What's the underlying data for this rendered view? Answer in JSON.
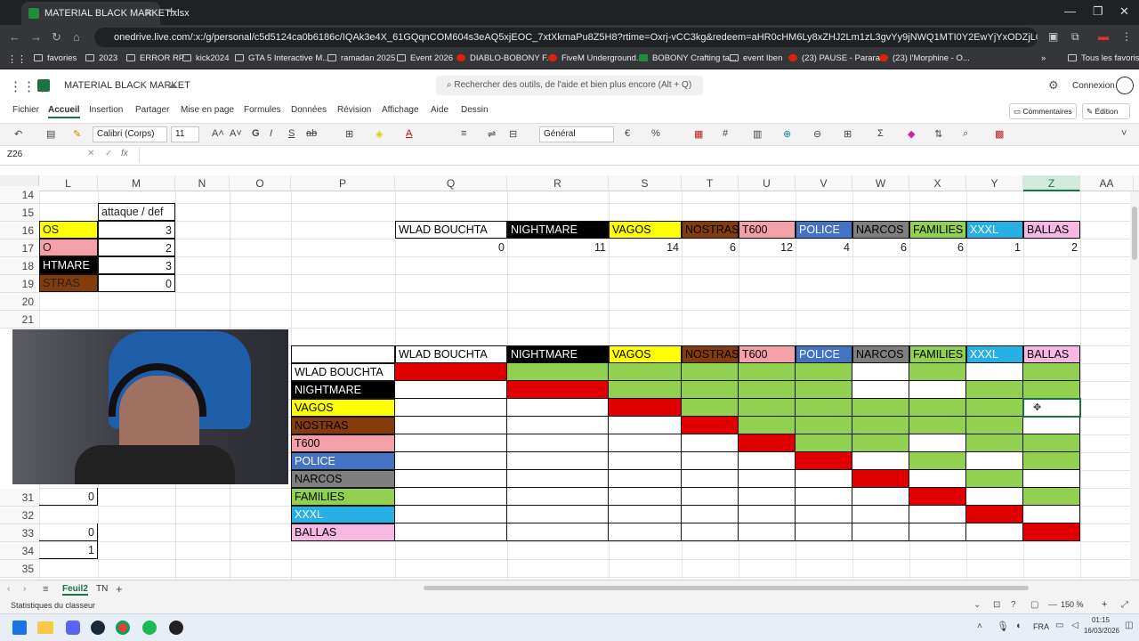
{
  "browser": {
    "tab_title": "MATERIAL BLACK MARKET.xlsx",
    "url": "onedrive.live.com/:x:/g/personal/c5d5124ca0b6186c/IQAk3e4X_61GQqnCOM604s3eAQ5xjEOC_7xtXkmaPu8Z5H8?rtime=Oxrj-vCC3kg&redeem=aHR0cHM6Ly8xZHJ2Lm1zL3gvYy9jNWQ1MTI0Y2EwYjYxODZjL0lRQWszZTRYXzYxR1FxbkNPTTYwNHMz",
    "bookmarks": [
      "favories",
      "2023",
      "ERROR RP",
      "kick2024",
      "GTA 5 Interactive M...",
      "ramadan 2025",
      "Event 2026",
      "DIABLO-BOBONY F...",
      "FiveM Underground...",
      "BOBONY Crafting ta...",
      "event Iben",
      "(23) PAUSE - Parara...",
      "(23) l'Morphine - O..."
    ],
    "all_favorites": "Tous les favoris"
  },
  "app": {
    "doc_title": "MATERIAL BLACK MARKET",
    "search_placeholder": "Rechercher des outils, de l'aide et bien plus encore (Alt + Q)",
    "signin": "Connexion",
    "comments": "Commentaires",
    "edit_mode": "Édition",
    "ribbon_tabs": [
      "Fichier",
      "Accueil",
      "Insertion",
      "Partager",
      "Mise en page",
      "Formules",
      "Données",
      "Révision",
      "Affichage",
      "Aide",
      "Dessin"
    ],
    "font_name": "Calibri (Corps)",
    "font_size": "11",
    "number_format": "Général",
    "name_box": "Z26"
  },
  "grid": {
    "columns": [
      "L",
      "M",
      "N",
      "O",
      "P",
      "Q",
      "R",
      "S",
      "T",
      "U",
      "V",
      "W",
      "X",
      "Y",
      "Z",
      "AA"
    ],
    "selected_column": "Z",
    "rows": [
      "14",
      "15",
      "16",
      "17",
      "18",
      "19",
      "20",
      "21",
      "31",
      "32",
      "33",
      "34",
      "35"
    ],
    "left_table": {
      "header": "attaque / def",
      "names": [
        "OS",
        "O",
        "HTMARE",
        "STRAS"
      ],
      "values": [
        "3",
        "2",
        "3",
        "0"
      ]
    },
    "left_lower_values": {
      "r31": "0",
      "r33": "0",
      "r34": "1"
    },
    "top_table": {
      "gangs": [
        "WLAD BOUCHTA",
        "NIGHTMARE",
        "VAGOS",
        "NOSTRAS",
        "T600",
        "POLICE",
        "NARCOS",
        "FAMILIES",
        "XXXL",
        "BALLAS"
      ],
      "counts": [
        "0",
        "11",
        "14",
        "6",
        "12",
        "4",
        "6",
        "6",
        "1",
        "2"
      ]
    },
    "gang_colors": [
      "#ffffff",
      "#000000",
      "#ffff00",
      "#843c0c",
      "#f4a0a8",
      "#4472c4",
      "#7f7f7f",
      "#92d050",
      "#26b0e6",
      "#f7b7e3"
    ],
    "gang_text_colors": [
      "#000000",
      "#ffffff",
      "#000000",
      "#000000",
      "#000000",
      "#ffffff",
      "#000000",
      "#000000",
      "#ffffff",
      "#000000"
    ],
    "matrix_legend": {
      "red": "#e00000",
      "green": "#92d050"
    },
    "matrix": [
      [
        "R",
        "G",
        "G",
        "G",
        "G",
        "G",
        "W",
        "G",
        "W",
        "G"
      ],
      [
        "W",
        "R",
        "G",
        "G",
        "G",
        "G",
        "W",
        "W",
        "G",
        "G"
      ],
      [
        "W",
        "W",
        "R",
        "G",
        "G",
        "G",
        "G",
        "G",
        "G",
        "W"
      ],
      [
        "W",
        "W",
        "W",
        "R",
        "G",
        "G",
        "G",
        "G",
        "G",
        "W"
      ],
      [
        "W",
        "W",
        "W",
        "W",
        "R",
        "G",
        "G",
        "W",
        "G",
        "G"
      ],
      [
        "W",
        "W",
        "W",
        "W",
        "W",
        "R",
        "W",
        "G",
        "W",
        "G"
      ],
      [
        "W",
        "W",
        "W",
        "W",
        "W",
        "W",
        "R",
        "W",
        "G",
        "W"
      ],
      [
        "W",
        "W",
        "W",
        "W",
        "W",
        "W",
        "W",
        "R",
        "W",
        "G"
      ],
      [
        "W",
        "W",
        "W",
        "W",
        "W",
        "W",
        "W",
        "W",
        "R",
        "W"
      ],
      [
        "W",
        "W",
        "W",
        "W",
        "W",
        "W",
        "W",
        "W",
        "W",
        "R"
      ]
    ]
  },
  "sheets": [
    "Feuil2",
    "TN"
  ],
  "status": {
    "left": "Statistiques du classeur",
    "zoom": "150 %",
    "lang": "FRA",
    "time": "01:15",
    "date": "16/03/2026"
  }
}
